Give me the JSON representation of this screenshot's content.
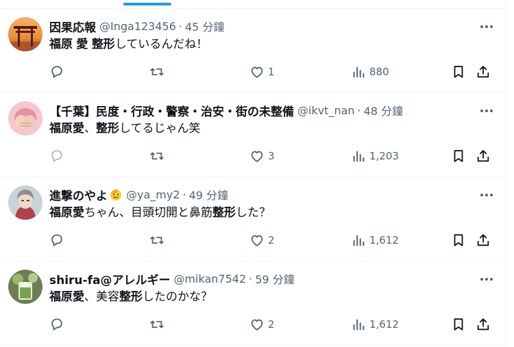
{
  "tweets": [
    {
      "name": "因果応報",
      "handle": "@Inga123456",
      "time": "45 分鐘",
      "text_parts": [
        "福原",
        " ",
        "愛",
        " ",
        "整形",
        "しているんだね！"
      ],
      "replies": "",
      "retweets": "",
      "likes": "1",
      "views": "880",
      "avatar": "torii-avatar"
    },
    {
      "name": "【千葉】民度・行政・警察・治安・街の未整備",
      "handle": "@ikvt_nan",
      "time": "48 分鐘",
      "text_parts": [
        "福原愛",
        "、",
        "整形",
        "してるじゃん笑"
      ],
      "replies": "",
      "retweets": "",
      "likes": "3",
      "views": "1,203",
      "avatar": "hands-heart-avatar"
    },
    {
      "name": "進撃のやよ",
      "handle": "@ya_my2",
      "time": "49 分鐘",
      "text_parts": [
        "福原愛",
        "ちゃん、目頭切開と鼻筋",
        "整形",
        "した？"
      ],
      "replies": "",
      "retweets": "",
      "likes": "2",
      "views": "1,612",
      "avatar": "anime-character-avatar"
    },
    {
      "name": "shiru-fa@アレルギー",
      "handle": "@mikan7542",
      "time": "59 分鐘",
      "text_parts": [
        "福原愛",
        "、美容",
        "整形",
        "したのかな？"
      ],
      "replies": "",
      "retweets": "",
      "likes": "2",
      "views": "1,612",
      "avatar": "drink-avatar"
    }
  ],
  "separator": "·",
  "colors": {
    "text": "#0f1419",
    "secondary": "#536471",
    "divider": "#eff3f4",
    "accent": "#1d9bf0"
  },
  "icons": [
    "reply-icon",
    "retweet-icon",
    "like-icon",
    "views-icon",
    "bookmark-icon",
    "share-icon",
    "more-icon"
  ]
}
